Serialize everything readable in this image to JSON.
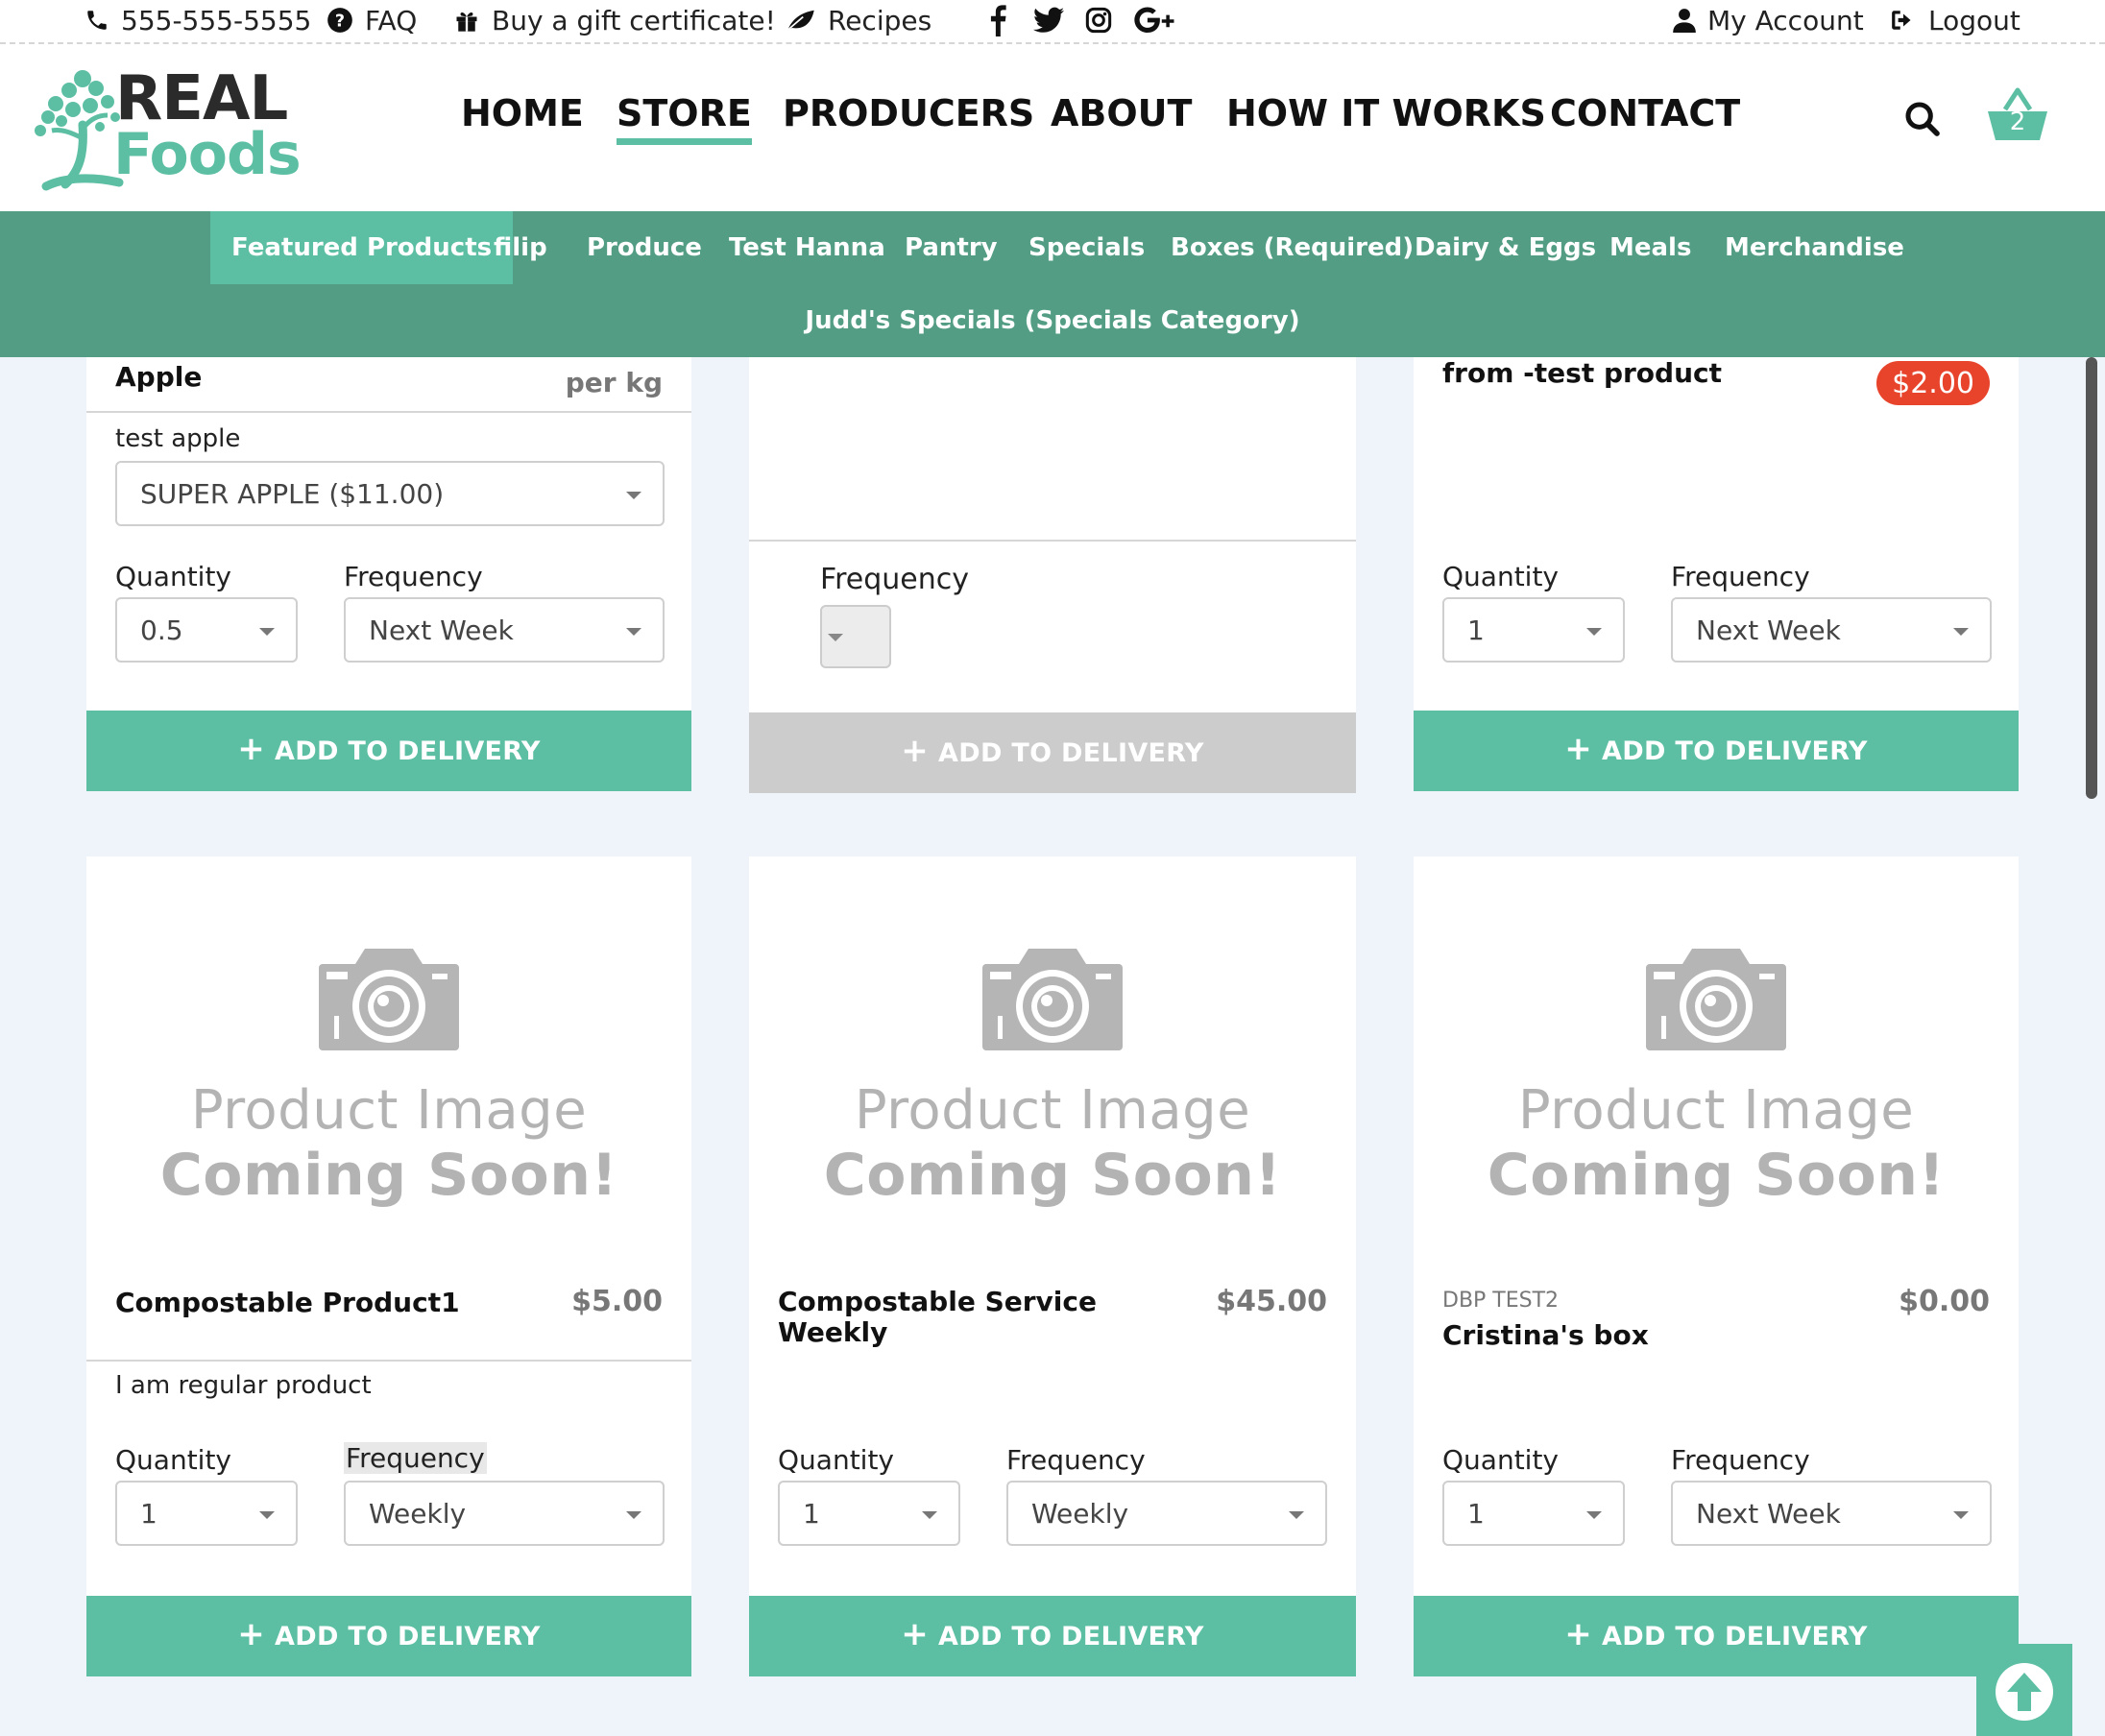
{
  "topbar": {
    "phone": "555-555-5555",
    "faq": "FAQ",
    "gift": "Buy a gift certificate!",
    "recipes": "Recipes",
    "social": [
      "facebook-icon",
      "twitter-icon",
      "instagram-icon",
      "google-plus-icon"
    ],
    "account": "My Account",
    "logout": "Logout"
  },
  "logo": {
    "line1": "REAL",
    "line2": "Foods"
  },
  "nav": {
    "home": "HOME",
    "store": "STORE",
    "producers": "PRODUCERS",
    "about": "ABOUT",
    "how": "HOW IT WORKS",
    "contact": "CONTACT",
    "cart_count": "2"
  },
  "categories": {
    "row1": [
      "Featured Products",
      "filip",
      "Produce",
      "Test Hanna",
      "Pantry",
      "Specials",
      "Boxes (Required)",
      "Dairy & Eggs",
      "Meals",
      "Merchandise"
    ],
    "row2": "Judd's Specials (Specials Category)"
  },
  "common": {
    "quantity": "Quantity",
    "frequency": "Frequency",
    "add": "ADD TO DELIVERY",
    "ph_line1": "Product Image",
    "ph_line2": "Coming Soon!"
  },
  "cards_top": [
    {
      "name": "Apple",
      "unit": "per kg",
      "desc": "test apple",
      "variant": "SUPER APPLE ($11.00)",
      "quantity": "0.5",
      "frequency": "Next Week"
    },
    {
      "frequency_label": "Frequency"
    },
    {
      "name": "from -test product",
      "price": "$2.00",
      "quantity": "1",
      "frequency": "Next Week"
    }
  ],
  "cards_bottom": [
    {
      "name": "Compostable Product1",
      "price": "$5.00",
      "desc": "I am regular product",
      "quantity": "1",
      "frequency": "Weekly"
    },
    {
      "name_l1": "Compostable Service",
      "name_l2": "Weekly",
      "price": "$45.00",
      "quantity": "1",
      "frequency": "Weekly"
    },
    {
      "sub": "DBP TEST2",
      "name": "Cristina's box",
      "price": "$0.00",
      "quantity": "1",
      "frequency": "Next Week"
    }
  ],
  "colors": {
    "accent": "#5cbfa3",
    "catbar": "#529d84",
    "sale": "#e8442c"
  }
}
